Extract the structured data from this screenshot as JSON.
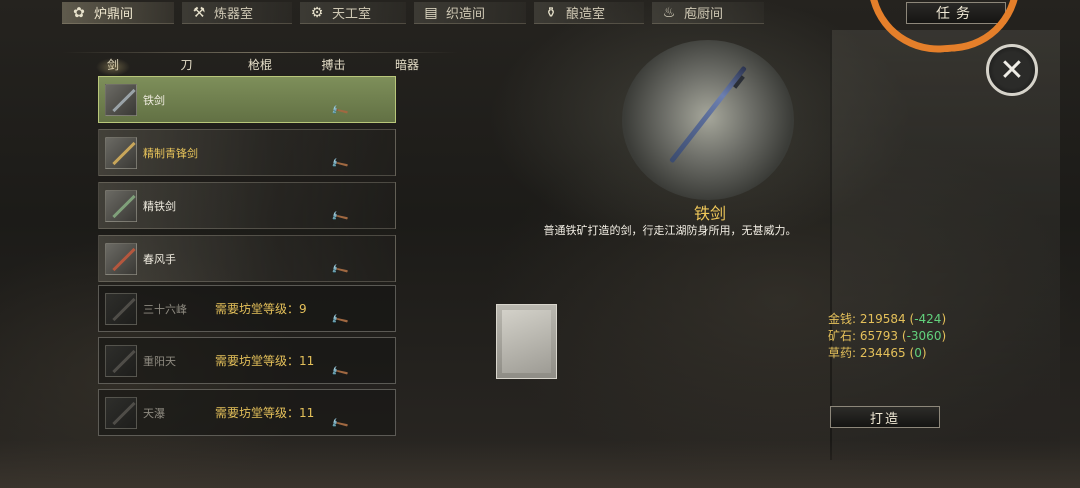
{
  "top_tabs": [
    {
      "label": "炉鼎间",
      "icon": "cauldron-icon",
      "active": true
    },
    {
      "label": "炼器室",
      "icon": "anvil-icon",
      "active": false
    },
    {
      "label": "天工室",
      "icon": "gear-scroll-icon",
      "active": false
    },
    {
      "label": "织造间",
      "icon": "loom-icon",
      "active": false
    },
    {
      "label": "酿造室",
      "icon": "jar-icon",
      "active": false
    },
    {
      "label": "庖厨间",
      "icon": "stove-icon",
      "active": false
    }
  ],
  "task_button": "任务",
  "sub_tabs": [
    {
      "label": "剑",
      "active": true
    },
    {
      "label": "刀",
      "active": false
    },
    {
      "label": "枪棍",
      "active": false
    },
    {
      "label": "搏击",
      "active": false
    },
    {
      "label": "暗器",
      "active": false
    }
  ],
  "items": [
    {
      "name": "铁剑",
      "requirement": "",
      "selected": true,
      "locked": false,
      "icon": "iron-sword-icon"
    },
    {
      "name": "精制青锋剑",
      "requirement": "",
      "selected": false,
      "locked": false,
      "icon": "green-blade-sword-icon"
    },
    {
      "name": "精铁剑",
      "requirement": "",
      "selected": false,
      "locked": false,
      "icon": "refined-iron-sword-icon"
    },
    {
      "name": "春风手",
      "requirement": "",
      "selected": false,
      "locked": false,
      "icon": "spring-breeze-sword-icon"
    },
    {
      "name": "三十六峰",
      "requirement": "需要坊堂等级：9",
      "selected": false,
      "locked": true,
      "icon": "sword-icon"
    },
    {
      "name": "重阳天",
      "requirement": "需要坊堂等级：11",
      "selected": false,
      "locked": true,
      "icon": "sword-icon"
    },
    {
      "name": "天瀑",
      "requirement": "需要坊堂等级：11",
      "selected": false,
      "locked": true,
      "icon": "sword-icon"
    }
  ],
  "detail": {
    "title": "铁剑",
    "description": "普通铁矿打造的剑，行走江湖防身所用，无甚威力。"
  },
  "resources": [
    {
      "label": "金钱:",
      "value": "219584",
      "diff": "-424"
    },
    {
      "label": "矿石:",
      "value": "65793",
      "diff": "-3060"
    },
    {
      "label": "草药:",
      "value": "234465",
      "diff": "0"
    }
  ],
  "build_button": "打造",
  "colors": {
    "accent_gold": "#e4c05a",
    "selected_green": "#7e8f5a",
    "diff_green": "#62d17c",
    "annotation_orange": "#e57f2a"
  }
}
